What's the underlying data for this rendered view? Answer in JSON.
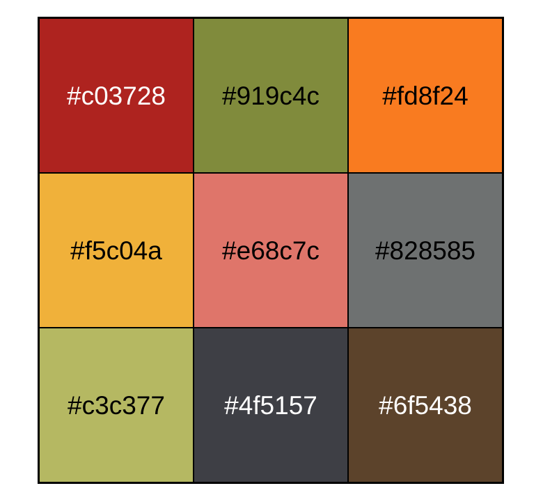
{
  "swatches": [
    {
      "label": "#c03728",
      "fill": "#ae231f",
      "text_color": "#ffffff"
    },
    {
      "label": "#919c4c",
      "fill": "#808b3c",
      "text_color": "#000000"
    },
    {
      "label": "#fd8f24",
      "fill": "#f97b20",
      "text_color": "#000000"
    },
    {
      "label": "#f5c04a",
      "fill": "#f0b13a",
      "text_color": "#000000"
    },
    {
      "label": "#e68c7c",
      "fill": "#df756a",
      "text_color": "#000000"
    },
    {
      "label": "#828585",
      "fill": "#6e7171",
      "text_color": "#000000"
    },
    {
      "label": "#c3c377",
      "fill": "#b5b862",
      "text_color": "#000000"
    },
    {
      "label": "#4f5157",
      "fill": "#3e3f45",
      "text_color": "#ffffff"
    },
    {
      "label": "#6f5438",
      "fill": "#5c432b",
      "text_color": "#ffffff"
    }
  ]
}
